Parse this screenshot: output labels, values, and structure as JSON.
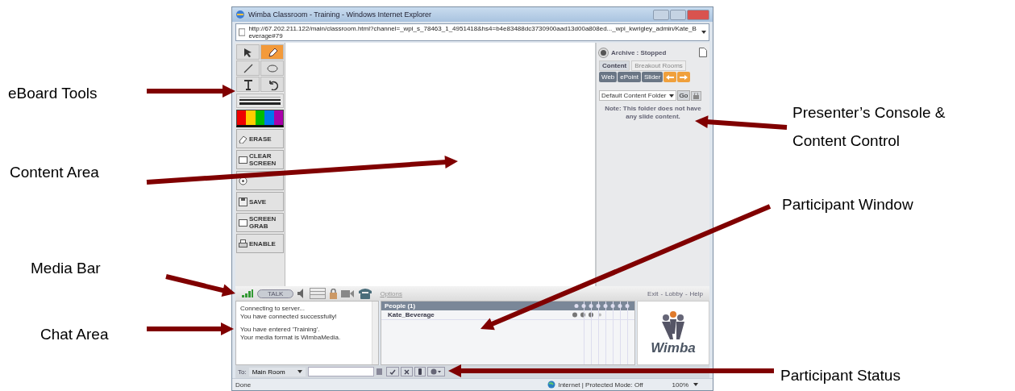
{
  "window": {
    "title": "Wimba Classroom - Training - Windows Internet Explorer",
    "url": "http://67.202.211.122/main/classroom.html?channel=_wpi_s_78463_1_4951418&hs4=b4e83488dc3730900aad13d00a808ed..._wpi_kwrigley_admin/Kate_Beverage#79"
  },
  "eboard_tools": [
    {
      "kind": "pointer",
      "selected": false
    },
    {
      "kind": "pen",
      "selected": true
    },
    {
      "kind": "line",
      "selected": false
    },
    {
      "kind": "ellipse",
      "selected": false
    },
    {
      "kind": "text",
      "selected": false
    },
    {
      "kind": "undo",
      "selected": false
    }
  ],
  "tool_buttons": [
    {
      "kind": "erase",
      "label": "ERASE"
    },
    {
      "kind": "clear",
      "label": "CLEAR SCREEN"
    },
    {
      "kind": "show"
    },
    {
      "kind": "save",
      "label": "SAVE"
    },
    {
      "kind": "grab",
      "label": "SCREEN GRAB"
    },
    {
      "kind": "print",
      "label": "ENABLE"
    }
  ],
  "console": {
    "archive": "Archive : Stopped",
    "tabs": [
      {
        "label": "Content",
        "selected": true
      },
      {
        "label": "Breakout Rooms",
        "selected": false
      }
    ],
    "buttons": [
      {
        "kind": "text",
        "label": "Web"
      },
      {
        "kind": "text",
        "label": "ePoint"
      },
      {
        "kind": "text",
        "label": "Slider"
      },
      {
        "kind": "prev"
      },
      {
        "kind": "next"
      }
    ],
    "folder": "Default Content Folder",
    "go": "Go",
    "note": "Note: This folder does not have any slide content."
  },
  "media_bar": {
    "talk": "TALK",
    "options": "Options",
    "links": [
      "Exit",
      "Lobby",
      "Help"
    ],
    "separator": "-"
  },
  "chat": {
    "blocks": [
      [
        "Connecting to server...",
        "You have connected successfully!"
      ],
      [
        "You have entered 'Training'.",
        "Your media format is WimbaMedia."
      ]
    ],
    "to": "To:",
    "room": "Main Room"
  },
  "participants": {
    "header": "People (1)",
    "rows": [
      "Kate_Beverage"
    ]
  },
  "logo": "Wimba",
  "status_bar": {
    "left": "Done",
    "zone": "Internet | Protected Mode: Off",
    "zoom": "100%"
  },
  "callouts": [
    {
      "text": "eBoard Tools"
    },
    {
      "text": "Content Area"
    },
    {
      "text": "Media Bar"
    },
    {
      "text": "Chat Area"
    },
    {
      "text": "Presenter’s Console &\nContent Control"
    },
    {
      "text": "Participant Window"
    },
    {
      "text": "Participant Status"
    }
  ]
}
